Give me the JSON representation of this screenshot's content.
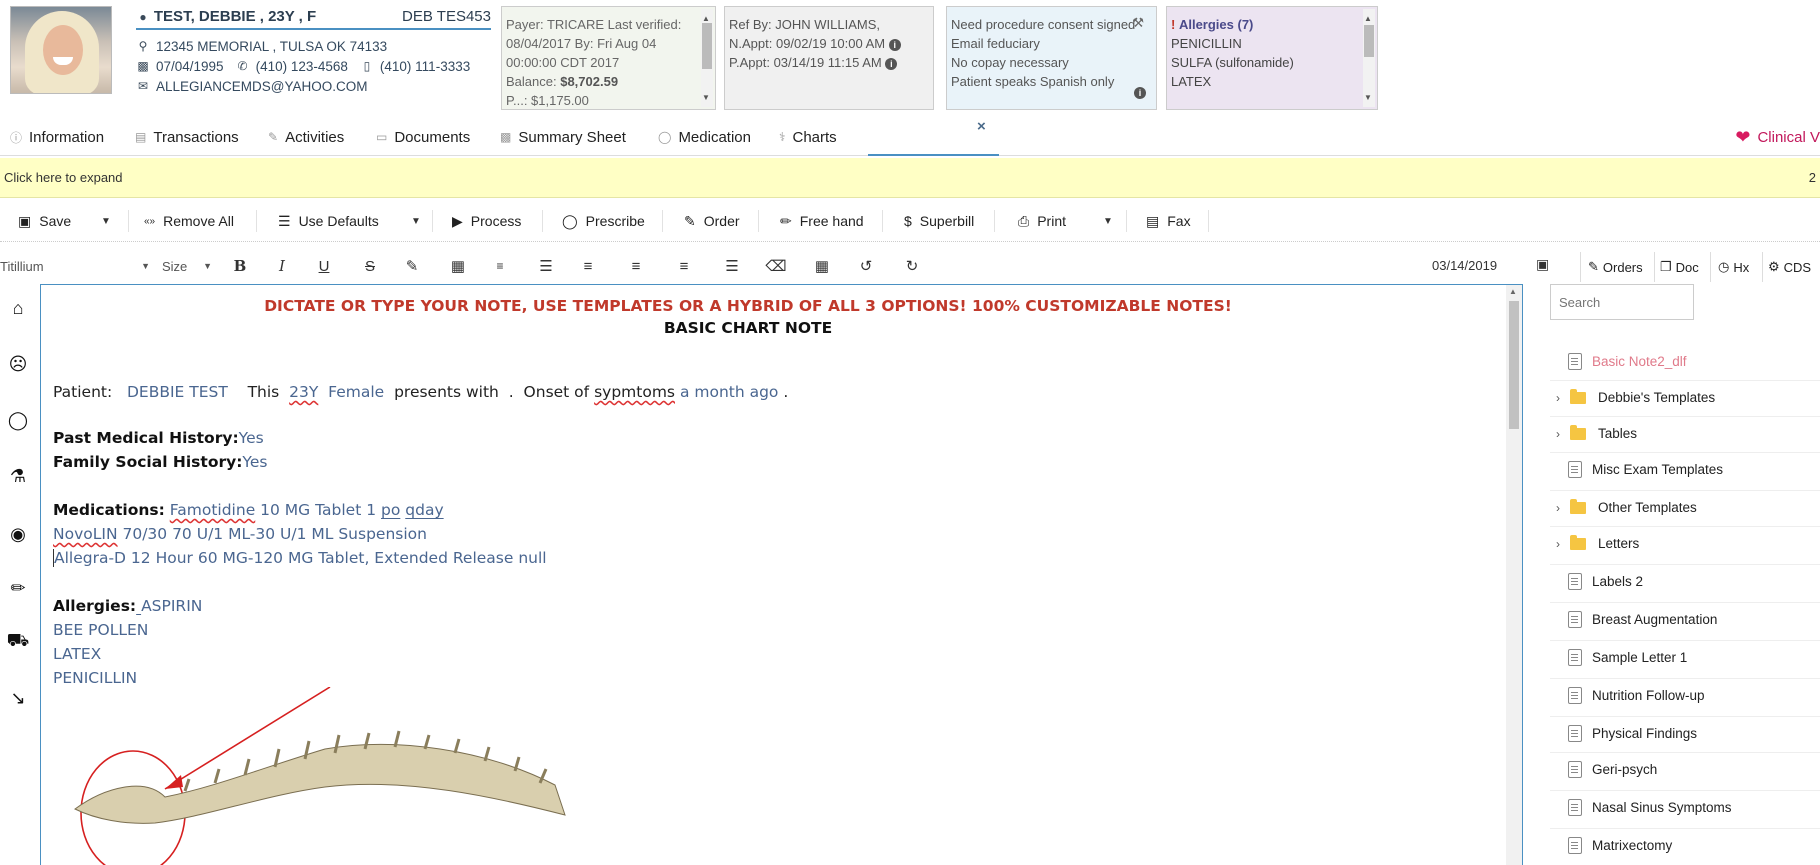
{
  "patient": {
    "name": "TEST, DEBBIE , 23Y , F",
    "account": "DEB TES453",
    "address": "12345 MEMORIAL , TULSA OK 74133",
    "dob": "07/04/1995",
    "phone1": "(410) 123-4568",
    "phone2": "(410) 111-3333",
    "email": "ALLEGIANCEMDS@YAHOO.COM"
  },
  "cards": {
    "payer": {
      "line1": "Payer: TRICARE Last verified:",
      "line2": "08/04/2017 By: Fri Aug 04",
      "line3": "00:00:00 CDT 2017",
      "balance_label": "Balance:",
      "balance_value": "$8,702.59",
      "cut_line": "P...: $1,175.00"
    },
    "referral": {
      "ref_by": "Ref By: JOHN WILLIAMS,",
      "next_appt": "N.Appt: 09/02/19 10:00 AM",
      "prev_appt": "P.Appt: 03/14/19 11:15 AM"
    },
    "alerts": {
      "items": [
        "Need procedure consent signed",
        "Email feduciary",
        "No copay necessary",
        "Patient speaks Spanish only"
      ]
    },
    "allergies": {
      "title": "Allergies (7)",
      "items": [
        "PENICILLIN",
        "SULFA (sulfonamide)",
        "LATEX"
      ]
    }
  },
  "tabs": {
    "information": "Information",
    "transactions": "Transactions",
    "activities": "Activities",
    "documents": "Documents",
    "summary": "Summary Sheet",
    "medication": "Medication",
    "charts": "Charts",
    "close": "×",
    "clinical": "Clinical V"
  },
  "expand": {
    "text": "Click here to expand",
    "count": "2"
  },
  "actions": {
    "save": "Save",
    "remove_all": "Remove All",
    "use_defaults": "Use Defaults",
    "process": "Process",
    "prescribe": "Prescribe",
    "order": "Order",
    "free_hand": "Free hand",
    "superbill": "Superbill",
    "print": "Print",
    "fax": "Fax"
  },
  "format": {
    "font": "Titillium",
    "size": "Size",
    "date": "03/14/2019"
  },
  "right_tabs": {
    "orders": "Orders",
    "doc": "Doc",
    "hx": "Hx",
    "cds": "CDS"
  },
  "note": {
    "header": "DICTATE OR TYPE YOUR NOTE, USE TEMPLATES OR A HYBRID OF ALL 3 OPTIONS!  100%  CUSTOMIZABLE NOTES!",
    "title": "BASIC CHART NOTE",
    "patient_label": "Patient:",
    "patient_name": "DEBBIE TEST",
    "this": "This",
    "age": "23Y",
    "gender": "Female",
    "presents": "presents with",
    "dot": ".",
    "onset": "Onset of",
    "symptoms": "sypmtoms",
    "ago": "a month ago",
    "end_dot": ".",
    "pmh_label": "Past Medical History:",
    "pmh_value": "Yes",
    "fsh_label": "Family Social History:",
    "fsh_value": "Yes",
    "med_label": "Medications:",
    "med1_a": "Famotidine",
    "med1_b": " 10 MG Tablet 1 ",
    "med1_c": "po",
    "med1_d": " ",
    "med1_e": "qday",
    "med2_a": "NovoLIN",
    "med2_b": " 70/30 70 U/1 ML-30 U/1 ML Suspension",
    "med3": "Allegra-D 12 Hour 60 MG-120 MG Tablet, Extended Release null",
    "allergy_label": "Allergies:",
    "allergy_gap": " ",
    "allergy_items": [
      "ASPIRIN",
      "BEE POLLEN",
      "LATEX",
      "PENICILLIN"
    ]
  },
  "sidebar": {
    "search_placeholder": "Search",
    "items": [
      {
        "label": "Basic Note2_dlf",
        "type": "doc"
      },
      {
        "label": "Debbie's Templates",
        "type": "folder"
      },
      {
        "label": "Tables",
        "type": "folder"
      },
      {
        "label": "Misc Exam Templates",
        "type": "doc"
      },
      {
        "label": "Other Templates",
        "type": "folder"
      },
      {
        "label": "Letters",
        "type": "folder"
      },
      {
        "label": "Labels 2",
        "type": "doc"
      },
      {
        "label": "Breast Augmentation",
        "type": "doc"
      },
      {
        "label": "Sample Letter 1",
        "type": "doc"
      },
      {
        "label": "Nutrition Follow-up",
        "type": "doc"
      },
      {
        "label": "Physical Findings",
        "type": "doc"
      },
      {
        "label": "Geri-psych",
        "type": "doc"
      },
      {
        "label": "Nasal Sinus Symptoms",
        "type": "doc"
      },
      {
        "label": "Matrixectomy",
        "type": "doc"
      }
    ]
  },
  "icons": {
    "accent": "#4a90c2",
    "header_red": "#c0392b",
    "expand_bg": "#ffffc5"
  }
}
